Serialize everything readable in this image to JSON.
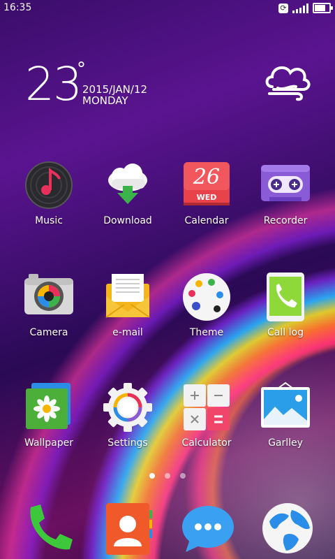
{
  "status": {
    "time": "16:35"
  },
  "clock": {
    "temperature": "23",
    "degree": "°",
    "date": "2015/JAN/12",
    "weekday": "MONDAY"
  },
  "calendar_icon": {
    "day": "26",
    "weekday": "WED"
  },
  "apps": [
    {
      "label": "Music",
      "icon": "music-icon"
    },
    {
      "label": "Download",
      "icon": "download-icon"
    },
    {
      "label": "Calendar",
      "icon": "calendar-icon"
    },
    {
      "label": "Recorder",
      "icon": "recorder-icon"
    },
    {
      "label": "Camera",
      "icon": "camera-icon"
    },
    {
      "label": "e-mail",
      "icon": "email-icon"
    },
    {
      "label": "Theme",
      "icon": "theme-icon"
    },
    {
      "label": "Call log",
      "icon": "call-log-icon"
    },
    {
      "label": "Wallpaper",
      "icon": "wallpaper-icon"
    },
    {
      "label": "Settings",
      "icon": "settings-icon"
    },
    {
      "label": "Calculator",
      "icon": "calculator-icon"
    },
    {
      "label": "Garlley",
      "icon": "gallery-icon"
    }
  ],
  "page_indicator": {
    "count": 3,
    "active": 1
  },
  "dock": [
    "phone-icon",
    "contacts-icon",
    "messages-icon",
    "browser-icon"
  ]
}
